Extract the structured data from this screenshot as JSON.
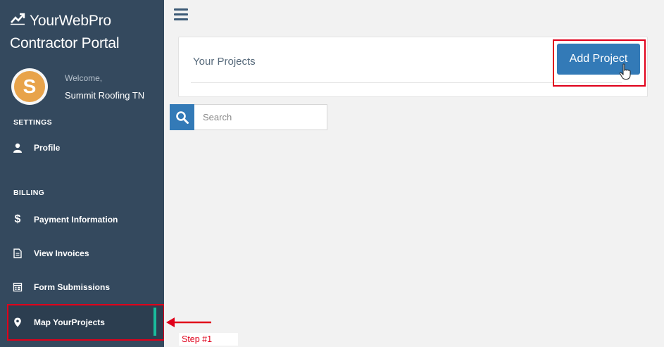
{
  "brand": {
    "title": "YourWebPro",
    "subtitle": "Contractor Portal"
  },
  "user": {
    "welcome": "Welcome,",
    "name": "Summit Roofing TN",
    "avatar_letter": "S"
  },
  "sidebar": {
    "sections": [
      {
        "title": "SETTINGS",
        "items": [
          {
            "label": "Profile",
            "icon": "user-icon"
          }
        ]
      },
      {
        "title": "BILLING",
        "items": [
          {
            "label": "Payment Information",
            "icon": "dollar-icon"
          },
          {
            "label": "View Invoices",
            "icon": "document-icon"
          },
          {
            "label": "Form Submissions",
            "icon": "form-icon"
          },
          {
            "label": "Map YourProjects",
            "icon": "map-pin-icon",
            "active": true
          }
        ]
      }
    ]
  },
  "main": {
    "panel_title": "Your Projects",
    "add_button": "Add Project",
    "search_placeholder": "Search"
  },
  "annotation": {
    "step": "Step #1"
  },
  "colors": {
    "sidebar": "#34495e",
    "accent": "#337ab7",
    "active_indicator": "#1abc9c",
    "highlight": "#e0001a"
  }
}
